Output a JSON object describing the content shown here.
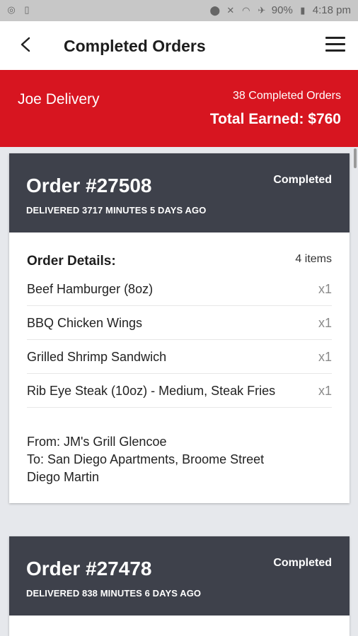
{
  "status_bar": {
    "battery": "90%",
    "time": "4:18 pm"
  },
  "header": {
    "title": "Completed Orders"
  },
  "banner": {
    "driver": "Joe Delivery",
    "completed_count": "38 Completed Orders",
    "total_earned": "Total Earned: $760"
  },
  "orders": [
    {
      "number": "Order #27508",
      "status": "Completed",
      "delivered": "DELIVERED 3717 MINUTES 5 DAYS AGO",
      "details_label": "Order Details:",
      "items_count": "4 items",
      "items": [
        {
          "name": "Beef Hamburger (8oz)",
          "qty": "x1"
        },
        {
          "name": "BBQ Chicken Wings",
          "qty": "x1"
        },
        {
          "name": "Grilled Shrimp Sandwich",
          "qty": "x1"
        },
        {
          "name": "Rib Eye Steak (10oz) - Medium, Steak Fries",
          "qty": "x1"
        }
      ],
      "from": "From: JM's Grill Glencoe",
      "to_line1": "To: San Diego Apartments, Broome Street",
      "to_line2": "Diego Martin"
    },
    {
      "number": "Order #27478",
      "status": "Completed",
      "delivered": "DELIVERED 838 MINUTES 6 DAYS AGO"
    }
  ],
  "colors": {
    "accent_red": "#d71520",
    "card_header": "#3e414b"
  }
}
